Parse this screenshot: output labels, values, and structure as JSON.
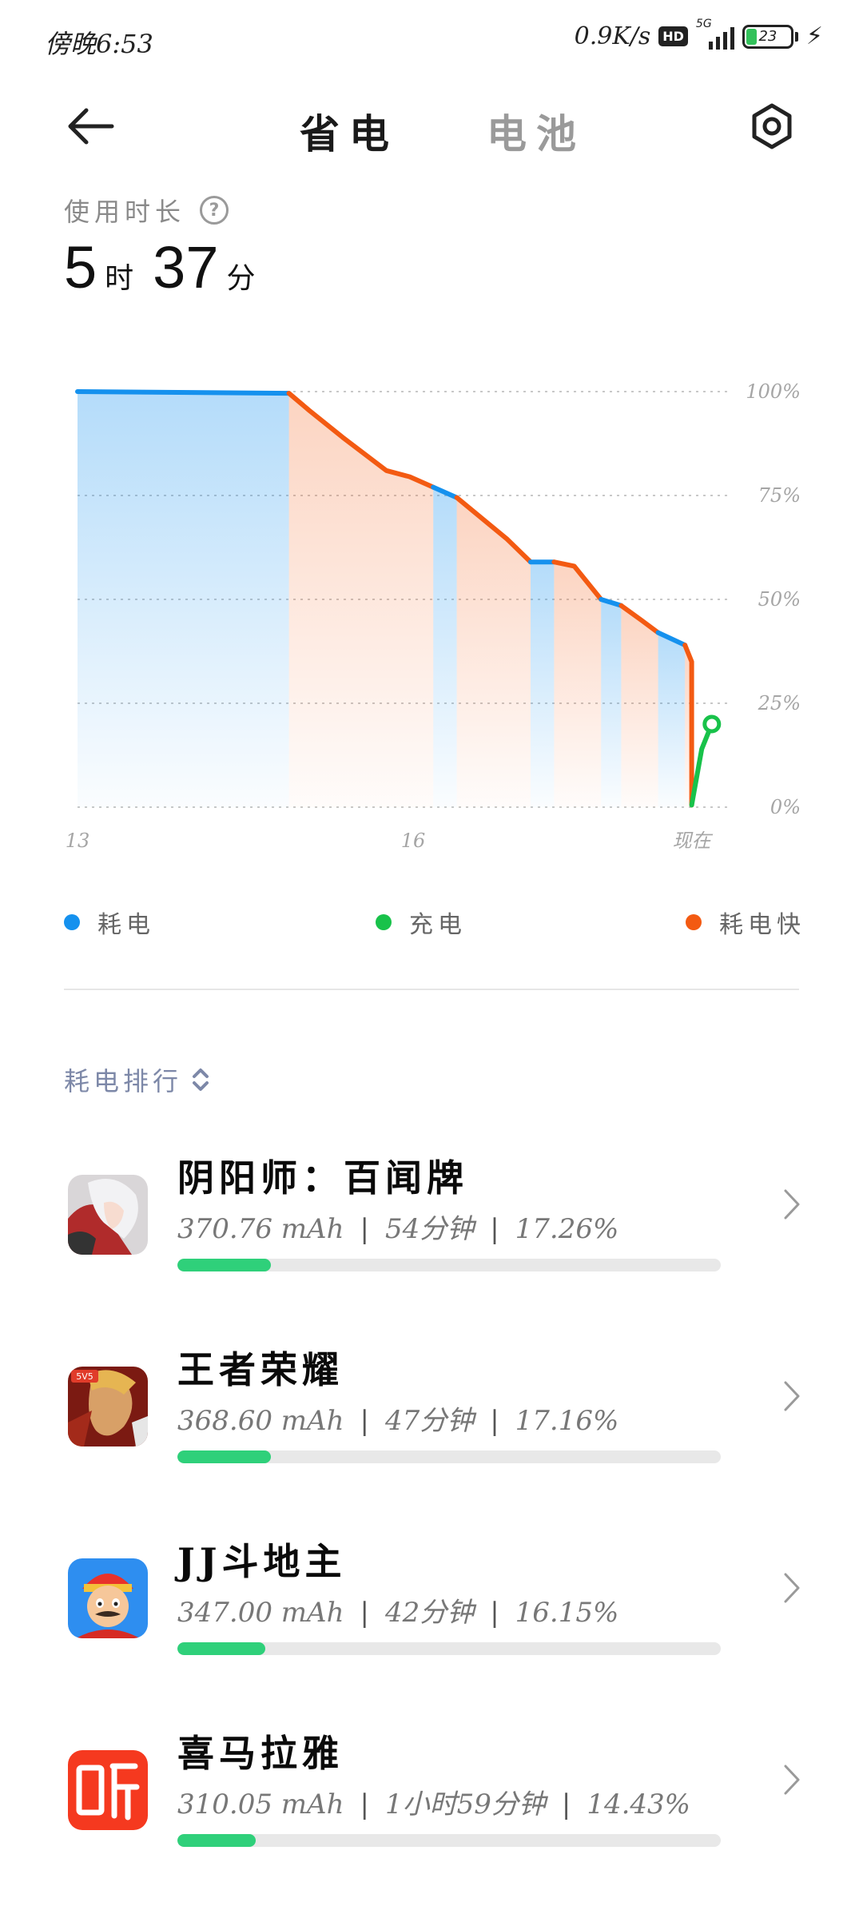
{
  "status_bar": {
    "time": "傍晚6:53",
    "net_speed": "0.9K/s",
    "hd": "HD",
    "network": "5G",
    "battery_level": "23"
  },
  "header": {
    "tabs": [
      {
        "label": "省电",
        "active": true
      },
      {
        "label": "电池",
        "active": false
      }
    ]
  },
  "usage": {
    "label": "使用时长",
    "hours": "5",
    "hours_unit": "时",
    "minutes": "37",
    "minutes_unit": "分"
  },
  "chart_data": {
    "type": "area",
    "y_ticks": [
      "100%",
      "75%",
      "50%",
      "25%",
      "0%"
    ],
    "x_ticks": [
      "13",
      "16",
      "现在"
    ],
    "ylim": [
      0,
      100
    ],
    "grid": true,
    "series": [
      {
        "name": "耗电",
        "color": "#1591ee",
        "points": [
          [
            0.0,
            100
          ],
          [
            0.63,
            99.6
          ]
        ]
      },
      {
        "name": "耗电快",
        "color": "#f35a12",
        "points": [
          [
            0.63,
            99.6
          ],
          [
            0.69,
            95.5
          ],
          [
            0.79,
            89
          ],
          [
            0.92,
            81
          ],
          [
            0.99,
            79.5
          ],
          [
            1.06,
            77
          ]
        ]
      },
      {
        "name": "耗电",
        "color": "#1591ee",
        "points": [
          [
            1.06,
            77
          ],
          [
            1.13,
            74.5
          ]
        ]
      },
      {
        "name": "耗电快",
        "color": "#f35a12",
        "points": [
          [
            1.13,
            74.5
          ],
          [
            1.22,
            68.5
          ],
          [
            1.28,
            64.5
          ],
          [
            1.35,
            59
          ]
        ]
      },
      {
        "name": "耗电",
        "color": "#1591ee",
        "points": [
          [
            1.35,
            59
          ],
          [
            1.42,
            59
          ]
        ]
      },
      {
        "name": "耗电快",
        "color": "#f35a12",
        "points": [
          [
            1.42,
            59
          ],
          [
            1.48,
            58
          ],
          [
            1.56,
            50
          ]
        ]
      },
      {
        "name": "耗电",
        "color": "#1591ee",
        "points": [
          [
            1.56,
            50
          ],
          [
            1.62,
            48.5
          ]
        ]
      },
      {
        "name": "耗电快",
        "color": "#f35a12",
        "points": [
          [
            1.62,
            48.5
          ],
          [
            1.68,
            45
          ],
          [
            1.73,
            42
          ]
        ]
      },
      {
        "name": "耗电",
        "color": "#1591ee",
        "points": [
          [
            1.73,
            42
          ],
          [
            1.81,
            39
          ]
        ]
      },
      {
        "name": "耗电快",
        "color": "#f35a12",
        "points": [
          [
            1.81,
            39
          ],
          [
            1.83,
            35
          ],
          [
            1.83,
            0.5
          ]
        ]
      },
      {
        "name": "充电",
        "color": "#18c24a",
        "points": [
          [
            1.83,
            0.5
          ],
          [
            1.86,
            14
          ],
          [
            1.89,
            20
          ]
        ]
      }
    ],
    "legend": [
      {
        "label": "耗电",
        "color": "#1591ee"
      },
      {
        "label": "充电",
        "color": "#18c24a"
      },
      {
        "label": "耗电快",
        "color": "#f35a12"
      }
    ]
  },
  "ranking": {
    "title": "耗电排行",
    "apps": [
      {
        "name": "阴阳师：百闻牌",
        "mah": "370.76 mAh",
        "time": "54分钟",
        "percent": "17.26%",
        "share": 0.1726,
        "icon": "onmyoji-icon"
      },
      {
        "name": "王者荣耀",
        "mah": "368.60 mAh",
        "time": "47分钟",
        "percent": "17.16%",
        "share": 0.1716,
        "icon": "honor-of-kings-icon"
      },
      {
        "name": "JJ斗地主",
        "mah": "347.00 mAh",
        "time": "42分钟",
        "percent": "16.15%",
        "share": 0.1615,
        "icon": "jj-doudizhu-icon"
      },
      {
        "name": "喜马拉雅",
        "mah": "310.05 mAh",
        "time": "1小时59分钟",
        "percent": "14.43%",
        "share": 0.1443,
        "icon": "ximalaya-icon"
      }
    ]
  }
}
